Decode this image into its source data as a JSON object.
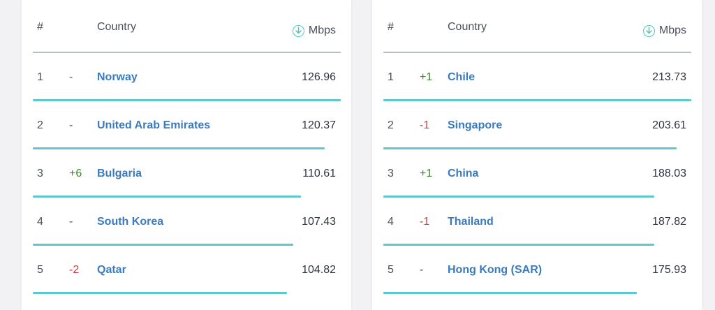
{
  "headers": {
    "rank": "#",
    "country": "Country",
    "speed": "Mbps",
    "speed_icon": "download-arrow-icon"
  },
  "colors": {
    "bar": "#5cc9ce",
    "link": "#3a7bbf",
    "up": "#3d8a2a",
    "down": "#d23b3b"
  },
  "tables": [
    {
      "rows": [
        {
          "rank": "1",
          "change": "-",
          "direction": "none",
          "country": "Norway",
          "speed": "126.96",
          "bar_fraction": 1.0
        },
        {
          "rank": "2",
          "change": "-",
          "direction": "none",
          "country": "United Arab Emirates",
          "speed": "120.37",
          "bar_fraction": 0.948
        },
        {
          "rank": "3",
          "change": "+6",
          "direction": "up",
          "country": "Bulgaria",
          "speed": "110.61",
          "bar_fraction": 0.871
        },
        {
          "rank": "4",
          "change": "-",
          "direction": "none",
          "country": "South Korea",
          "speed": "107.43",
          "bar_fraction": 0.846
        },
        {
          "rank": "5",
          "change": "-2",
          "direction": "down",
          "country": "Qatar",
          "speed": "104.82",
          "bar_fraction": 0.826
        }
      ]
    },
    {
      "rows": [
        {
          "rank": "1",
          "change": "+1",
          "direction": "up",
          "country": "Chile",
          "speed": "213.73",
          "bar_fraction": 1.0
        },
        {
          "rank": "2",
          "change": "-1",
          "direction": "down",
          "country": "Singapore",
          "speed": "203.61",
          "bar_fraction": 0.953
        },
        {
          "rank": "3",
          "change": "+1",
          "direction": "up",
          "country": "China",
          "speed": "188.03",
          "bar_fraction": 0.88
        },
        {
          "rank": "4",
          "change": "-1",
          "direction": "down",
          "country": "Thailand",
          "speed": "187.82",
          "bar_fraction": 0.879
        },
        {
          "rank": "5",
          "change": "-",
          "direction": "none",
          "country": "Hong Kong (SAR)",
          "speed": "175.93",
          "bar_fraction": 0.823
        }
      ]
    }
  ]
}
